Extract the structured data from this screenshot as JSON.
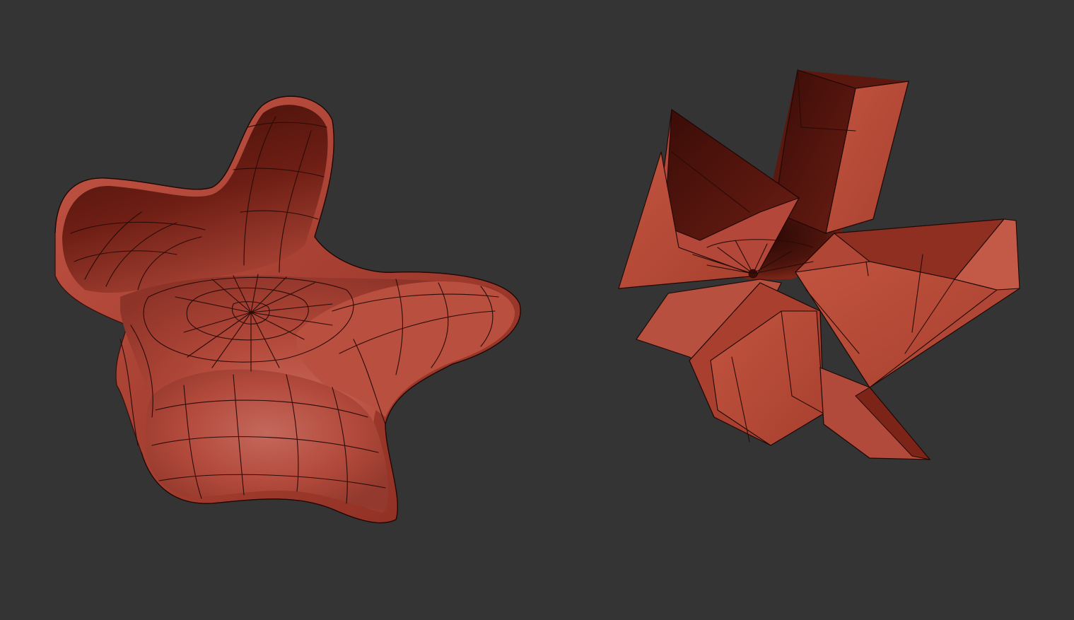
{
  "viewport": {
    "background_color": "#343434",
    "objects": [
      {
        "id": "smooth-subdivided-shell",
        "shading": "smooth",
        "wireframe_overlay": true,
        "material_color": "#b5473a"
      },
      {
        "id": "low-poly-cage-shell",
        "shading": "faceted",
        "wireframe_overlay": true,
        "material_color": "#b8483a"
      }
    ]
  }
}
